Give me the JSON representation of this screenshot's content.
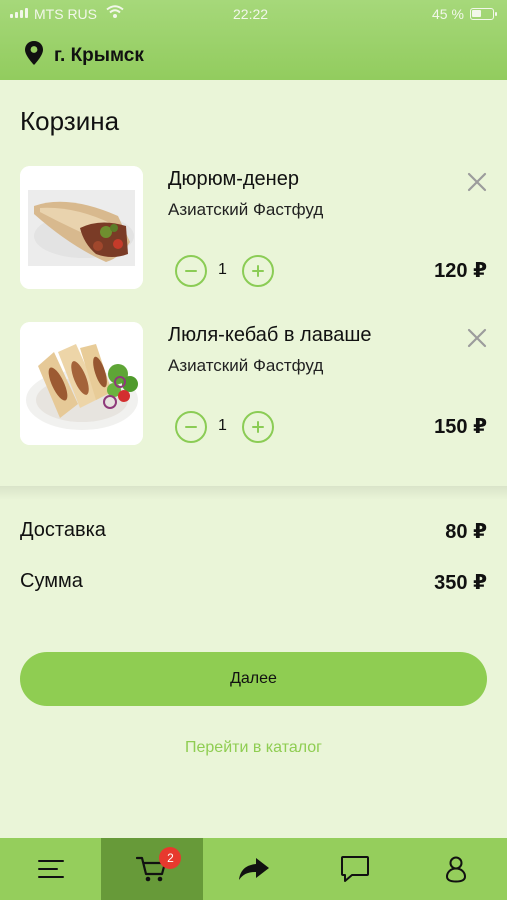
{
  "status_bar": {
    "carrier": "MTS RUS",
    "time": "22:22",
    "battery": "45 %"
  },
  "header": {
    "location_icon": "map-pin-icon",
    "city": "г. Крымск"
  },
  "page": {
    "title": "Корзина"
  },
  "cart": {
    "items": [
      {
        "name": "Дюрюм-денер",
        "shop": "Азиатский Фастфуд",
        "quantity": "1",
        "price": "120 ₽",
        "image": "durum-doner-image"
      },
      {
        "name": "Люля-кебаб в лаваше",
        "shop": "Азиатский Фастфуд",
        "quantity": "1",
        "price": "150 ₽",
        "image": "lula-kebab-image"
      }
    ]
  },
  "totals": {
    "delivery_label": "Доставка",
    "delivery_value": "80 ₽",
    "sum_label": "Сумма",
    "sum_value": "350 ₽"
  },
  "actions": {
    "next_label": "Далее",
    "catalog_link": "Перейти в каталог"
  },
  "bottom_nav": {
    "items": [
      {
        "icon": "menu-icon"
      },
      {
        "icon": "cart-icon",
        "badge": "2",
        "active": true
      },
      {
        "icon": "share-icon"
      },
      {
        "icon": "chat-icon"
      },
      {
        "icon": "profile-icon"
      }
    ]
  },
  "colors": {
    "accent": "#8fcd52",
    "header": "#95ce5c",
    "active_tab": "#679a39",
    "background": "#eaf5d8",
    "badge": "#e7392e"
  }
}
